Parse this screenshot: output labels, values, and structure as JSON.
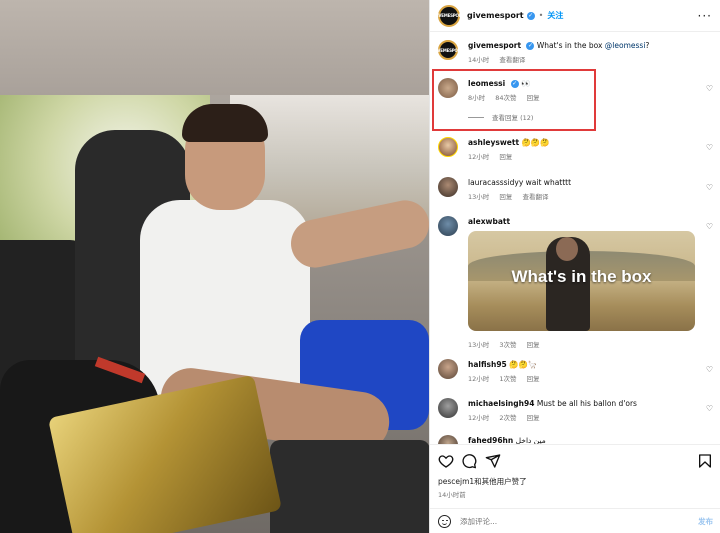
{
  "header": {
    "username": "givemesport",
    "follow_label": "关注",
    "more_label": "···",
    "avatar_text": "GIVEMESPORT"
  },
  "caption": {
    "username": "givemesport",
    "text": "What's in the box ",
    "mention": "@leomessi",
    "tail": "?",
    "time": "14小时",
    "translate": "查看翻译"
  },
  "comments": [
    {
      "username": "leomessi",
      "text": "👀",
      "time": "8小时",
      "likes": "84次赞",
      "reply": "回复",
      "replies": "查看回复 (12)"
    },
    {
      "username": "ashleyswett",
      "text": "🤔🤔🤔",
      "time": "12小时",
      "reply": "回复"
    },
    {
      "username": "lauracasssidyy",
      "text": "wait whatttt",
      "time": "13小时",
      "reply": "回复",
      "translate": "查看翻译"
    },
    {
      "username": "alexwbatt",
      "text": "",
      "time": "13小时",
      "likes": "3次赞",
      "reply": "回复",
      "gif_caption": "What's in the box"
    },
    {
      "username": "halfish95",
      "text": "🤔🤔🦙",
      "time": "12小时",
      "likes": "1次赞",
      "reply": "回复"
    },
    {
      "username": "michaelsingh94",
      "text": "Must be all his ballon d'ors",
      "time": "12小时",
      "likes": "2次赞",
      "reply": "回复"
    },
    {
      "username": "fahed96hn",
      "text": "مين داخل",
      "time": "",
      "reply": ""
    }
  ],
  "liked_by": "pescejm1和其他用户赞了",
  "post_time": "14小时前",
  "add_comment": {
    "placeholder": "添加评论...",
    "post_label": "发布"
  },
  "colors": {
    "accent": "#0095f6",
    "highlight": "#e03a3a",
    "verified": "#3897f0"
  }
}
